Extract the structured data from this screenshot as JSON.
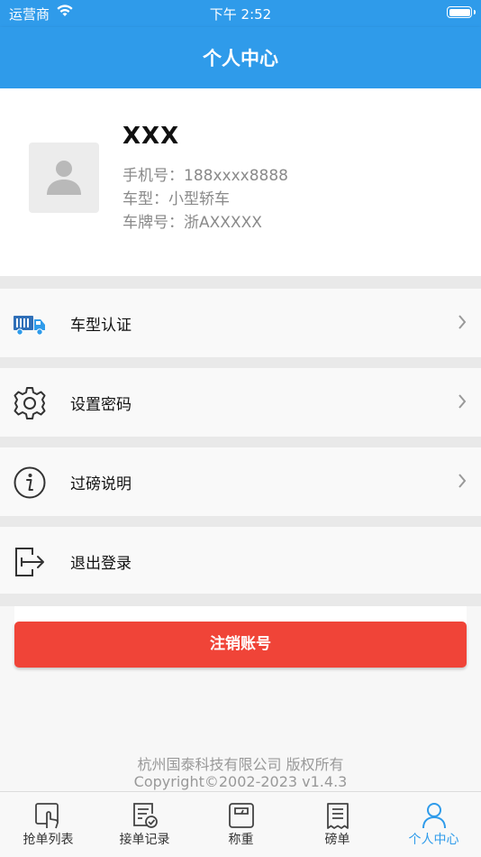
{
  "status_bar": {
    "carrier": "运营商",
    "time": "下午 2:52"
  },
  "header": {
    "title": "个人中心"
  },
  "profile": {
    "name": "XXX",
    "phone": "手机号：188xxxx8888",
    "car_type": "车型：小型轿车",
    "plate": "车牌号：浙AXXXXX"
  },
  "menu": [
    {
      "label": "车型认证",
      "icon": "truck-icon"
    },
    {
      "label": "设置密码",
      "icon": "gear-icon"
    },
    {
      "label": "过磅说明",
      "icon": "info-icon"
    },
    {
      "label": "退出登录",
      "icon": "logout-icon"
    }
  ],
  "cancel_button": "注销账号",
  "footer": {
    "company": "杭州国泰科技有限公司 版权所有",
    "copyright": "Copyright©2002-2023 v1.4.3"
  },
  "tabs": [
    {
      "label": "抢单列表",
      "icon": "touch-icon"
    },
    {
      "label": "接单记录",
      "icon": "order-check-icon"
    },
    {
      "label": "称重",
      "icon": "scale-icon"
    },
    {
      "label": "磅单",
      "icon": "receipt-icon"
    },
    {
      "label": "个人中心",
      "icon": "person-icon",
      "active": true
    }
  ],
  "colors": {
    "primary": "#2f9bea",
    "danger": "#f04438"
  }
}
